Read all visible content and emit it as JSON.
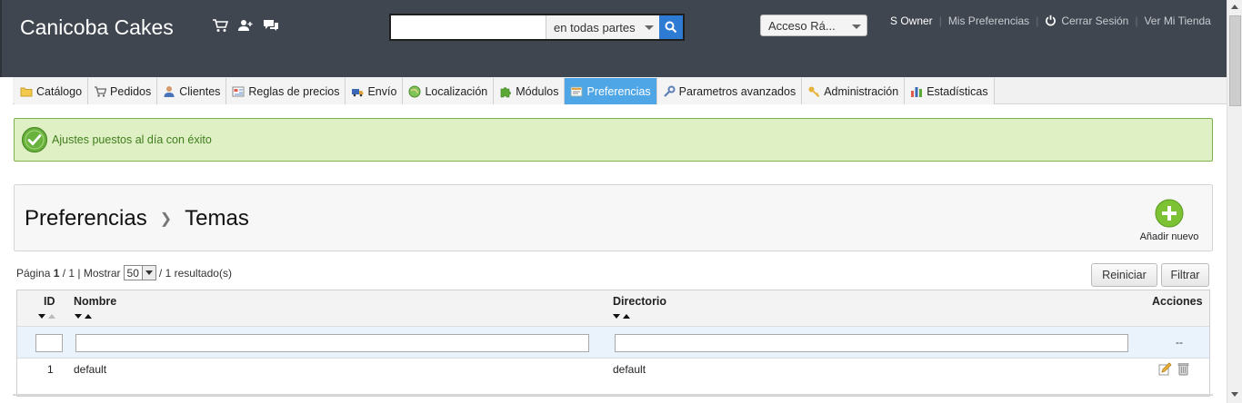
{
  "header": {
    "shop_name": "Canicoba Cakes",
    "search": {
      "value": "",
      "scope": "en todas partes"
    },
    "quick_access": "Acceso Rá...",
    "user_links": [
      "S Owner",
      "Mis Preferencias",
      "Cerrar Sesión",
      "Ver Mi Tienda"
    ]
  },
  "tabs": [
    {
      "label": "Catálogo",
      "icon": "folder-icon"
    },
    {
      "label": "Pedidos",
      "icon": "cart-icon"
    },
    {
      "label": "Clientes",
      "icon": "user-icon"
    },
    {
      "label": "Reglas de precios",
      "icon": "price-rules-icon"
    },
    {
      "label": "Envío",
      "icon": "truck-icon"
    },
    {
      "label": "Localización",
      "icon": "globe-icon"
    },
    {
      "label": "Módulos",
      "icon": "puzzle-icon"
    },
    {
      "label": "Preferencias",
      "icon": "preferences-icon",
      "active": true
    },
    {
      "label": "Parametros avanzados",
      "icon": "wrench-icon"
    },
    {
      "label": "Administración",
      "icon": "key-icon"
    },
    {
      "label": "Estadísticas",
      "icon": "stats-icon"
    }
  ],
  "alert": {
    "message": "Ajustes puestos al día con éxito"
  },
  "page": {
    "breadcrumb": [
      "Preferencias",
      "Temas"
    ],
    "add_new_label": "Añadir nuevo"
  },
  "pagination": {
    "page_label": "Página",
    "current": "1",
    "total": "/ 1 | Mostrar",
    "per_page": "50",
    "results": "/ 1 resultado(s)"
  },
  "buttons": {
    "reset": "Reiniciar",
    "filter": "Filtrar"
  },
  "table": {
    "columns": {
      "id": "ID",
      "name": "Nombre",
      "directory": "Directorio",
      "actions": "Acciones"
    },
    "filter_actions_placeholder": "--",
    "rows": [
      {
        "id": "1",
        "name": "default",
        "directory": "default"
      }
    ]
  },
  "colors": {
    "header_bg": "#3f4650",
    "active_tab": "#4fa6e6",
    "success_bg": "#dff0c5",
    "success_text": "#3f7d1c"
  }
}
